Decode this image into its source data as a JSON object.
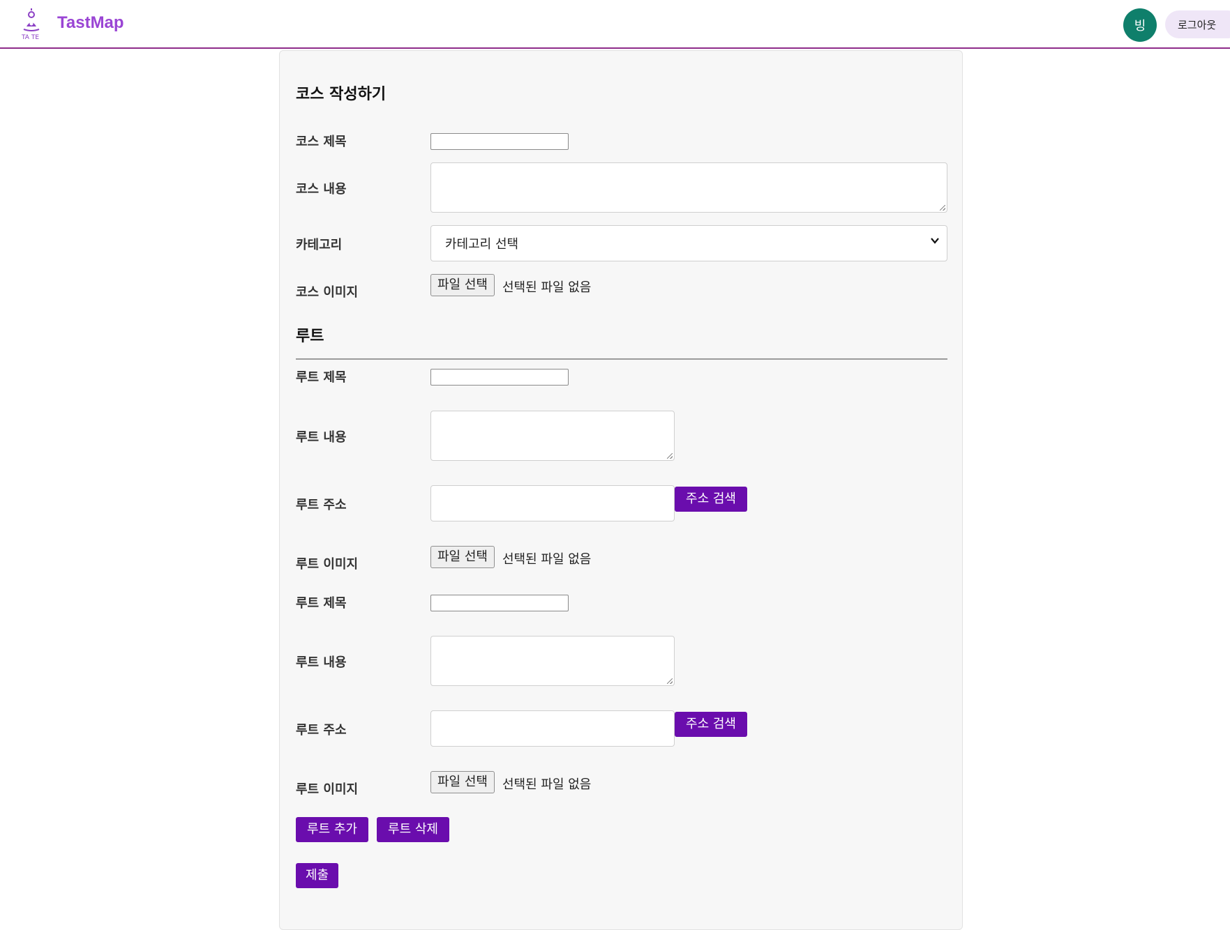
{
  "header": {
    "brand": "TastMap",
    "logo_icon": "taste-logo-icon",
    "avatar_initial": "빙",
    "logout_label": "로그아웃",
    "accent_color": "#9a45d4",
    "avatar_color": "#0f7f6b",
    "border_color": "#8e2c8a"
  },
  "course": {
    "section_title": "코스 작성하기",
    "title_label": "코스 제목",
    "title_value": "",
    "content_label": "코스 내용",
    "content_value": "",
    "category_label": "카테고리",
    "category_selected": "카테고리 선택",
    "image_label": "코스 이미지",
    "file_button": "파일 선택",
    "file_status": "선택된 파일 없음"
  },
  "routes_section": {
    "title": "루트",
    "routes": [
      {
        "title_label": "루트 제목",
        "title_value": "",
        "content_label": "루트 내용",
        "content_value": "",
        "address_label": "루트 주소",
        "address_value": "",
        "address_search_button": "주소 검색",
        "image_label": "루트 이미지",
        "file_button": "파일 선택",
        "file_status": "선택된 파일 없음"
      },
      {
        "title_label": "루트 제목",
        "title_value": "",
        "content_label": "루트 내용",
        "content_value": "",
        "address_label": "루트 주소",
        "address_value": "",
        "address_search_button": "주소 검색",
        "image_label": "루트 이미지",
        "file_button": "파일 선택",
        "file_status": "선택된 파일 없음"
      }
    ]
  },
  "actions": {
    "add_route": "루트 추가",
    "delete_route": "루트 삭제",
    "submit": "제출",
    "button_color": "#6a0dad"
  }
}
